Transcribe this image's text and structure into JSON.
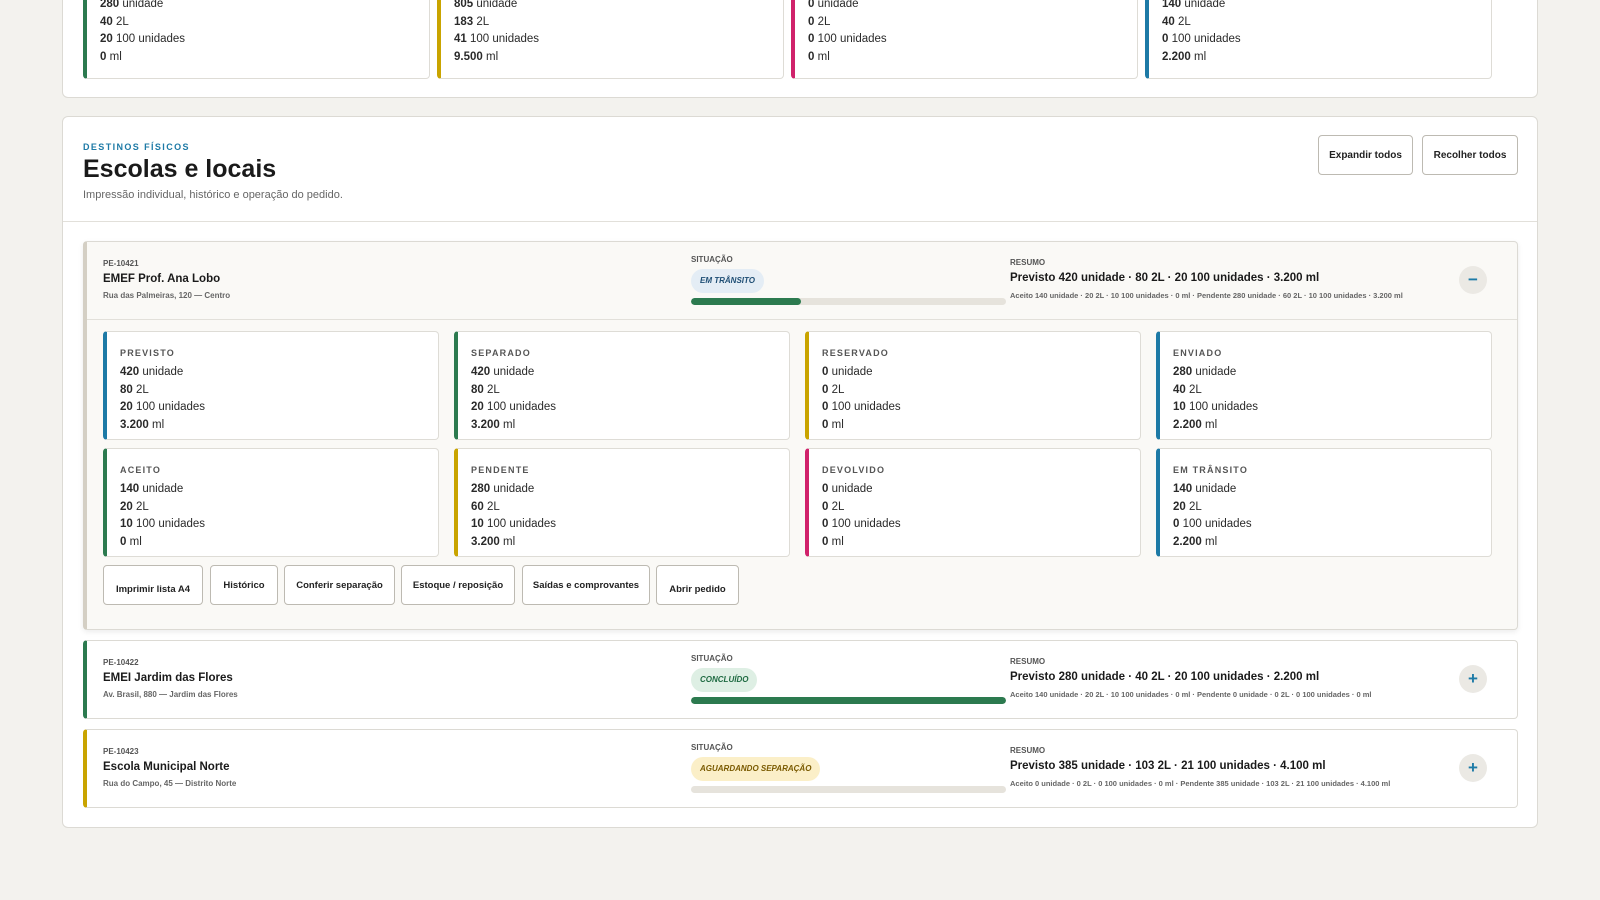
{
  "top_cards": [
    {
      "lines": [
        {
          "n": "280",
          "u": "unidade"
        },
        {
          "n": "40",
          "u": "2L"
        },
        {
          "n": "20",
          "u": "100 unidades"
        },
        {
          "n": "0",
          "u": "ml"
        }
      ]
    },
    {
      "lines": [
        {
          "n": "805",
          "u": "unidade"
        },
        {
          "n": "183",
          "u": "2L"
        },
        {
          "n": "41",
          "u": "100 unidades"
        },
        {
          "n": "9.500",
          "u": "ml"
        }
      ]
    },
    {
      "lines": [
        {
          "n": "0",
          "u": "unidade"
        },
        {
          "n": "0",
          "u": "2L"
        },
        {
          "n": "0",
          "u": "100 unidades"
        },
        {
          "n": "0",
          "u": "ml"
        }
      ]
    },
    {
      "lines": [
        {
          "n": "140",
          "u": "unidade"
        },
        {
          "n": "40",
          "u": "2L"
        },
        {
          "n": "0",
          "u": "100 unidades"
        },
        {
          "n": "2.200",
          "u": "ml"
        }
      ]
    }
  ],
  "section": {
    "kicker": "DESTINOS FÍSICOS",
    "title": "Escolas e locais",
    "subtitle": "Impressão individual, histórico e operação do pedido.",
    "expand_label": "Expandir todos",
    "collapse_label": "Recolher todos"
  },
  "labels": {
    "situacao": "SITUAÇÃO",
    "resumo": "RESUMO"
  },
  "orders": [
    {
      "code": "PE-10421",
      "name": "EMEF Prof. Ana Lobo",
      "address": "Rua das Palmeiras, 120 — Centro",
      "status": "EM TRÂNSITO",
      "status_color": "#e4edf5",
      "progress": 0.35,
      "summary": "Previsto 420 unidade · 80 2L · 20 100 unidades · 3.200 ml",
      "detail": "Aceito 140 unidade · 20 2L · 10 100 unidades · 0 ml · Pendente 280 unidade · 60 2L · 10 100 unidades · 3.200 ml",
      "toggle": "−",
      "accent": "#d4cfc4"
    },
    {
      "code": "PE-10422",
      "name": "EMEI Jardim das Flores",
      "address": "Av. Brasil, 880 — Jardim das Flores",
      "status": "CONCLUÍDO",
      "status_color": "#deefe4",
      "progress": 1.0,
      "summary": "Previsto 280 unidade · 40 2L · 20 100 unidades · 2.200 ml",
      "detail": "Aceito 140 unidade · 20 2L · 10 100 unidades · 0 ml · Pendente 0 unidade · 0 2L · 0 100 unidades · 0 ml",
      "toggle": "+",
      "accent": "#2c7a4f"
    },
    {
      "code": "PE-10423",
      "name": "Escola Municipal Norte",
      "address": "Rua do Campo, 45 — Distrito Norte",
      "status": "AGUARDANDO SEPARAÇÃO",
      "status_color": "#fbefc8",
      "progress": 0.0,
      "summary": "Previsto 385 unidade · 103 2L · 21 100 unidades · 4.100 ml",
      "detail": "Aceito 0 unidade · 0 2L · 0 100 unidades · 0 ml · Pendente 385 unidade · 103 2L · 21 100 unidades · 4.100 ml",
      "toggle": "+",
      "accent": "#c9a400"
    }
  ],
  "detail_cards": [
    {
      "label": "PREVISTO",
      "lines": [
        {
          "n": "420",
          "u": "unidade"
        },
        {
          "n": "80",
          "u": "2L"
        },
        {
          "n": "20",
          "u": "100 unidades"
        },
        {
          "n": "3.200",
          "u": "ml"
        }
      ]
    },
    {
      "label": "SEPARADO",
      "lines": [
        {
          "n": "420",
          "u": "unidade"
        },
        {
          "n": "80",
          "u": "2L"
        },
        {
          "n": "20",
          "u": "100 unidades"
        },
        {
          "n": "3.200",
          "u": "ml"
        }
      ]
    },
    {
      "label": "RESERVADO",
      "lines": [
        {
          "n": "0",
          "u": "unidade"
        },
        {
          "n": "0",
          "u": "2L"
        },
        {
          "n": "0",
          "u": "100 unidades"
        },
        {
          "n": "0",
          "u": "ml"
        }
      ]
    },
    {
      "label": "ENVIADO",
      "lines": [
        {
          "n": "280",
          "u": "unidade"
        },
        {
          "n": "40",
          "u": "2L"
        },
        {
          "n": "10",
          "u": "100 unidades"
        },
        {
          "n": "2.200",
          "u": "ml"
        }
      ]
    },
    {
      "label": "ACEITO",
      "lines": [
        {
          "n": "140",
          "u": "unidade"
        },
        {
          "n": "20",
          "u": "2L"
        },
        {
          "n": "10",
          "u": "100 unidades"
        },
        {
          "n": "0",
          "u": "ml"
        }
      ]
    },
    {
      "label": "PENDENTE",
      "lines": [
        {
          "n": "280",
          "u": "unidade"
        },
        {
          "n": "60",
          "u": "2L"
        },
        {
          "n": "10",
          "u": "100 unidades"
        },
        {
          "n": "3.200",
          "u": "ml"
        }
      ]
    },
    {
      "label": "DEVOLVIDO",
      "lines": [
        {
          "n": "0",
          "u": "unidade"
        },
        {
          "n": "0",
          "u": "2L"
        },
        {
          "n": "0",
          "u": "100 unidades"
        },
        {
          "n": "0",
          "u": "ml"
        }
      ]
    },
    {
      "label": "EM TRÂNSITO",
      "lines": [
        {
          "n": "140",
          "u": "unidade"
        },
        {
          "n": "20",
          "u": "2L"
        },
        {
          "n": "0",
          "u": "100 unidades"
        },
        {
          "n": "2.200",
          "u": "ml"
        }
      ]
    }
  ],
  "actions": [
    "Imprimir lista A4",
    "Histórico",
    "Conferir separação",
    "Estoque / reposição",
    "Saídas e comprovantes",
    "Abrir pedido"
  ],
  "colors": {
    "green": "#2c7a4f",
    "yellow": "#c9a400",
    "pink": "#d0226b",
    "blue": "#1d7aa6"
  }
}
